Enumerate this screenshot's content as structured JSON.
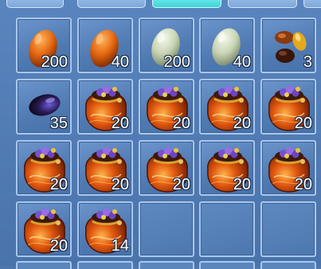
{
  "inventory": {
    "slots": [
      {
        "item": "orange-egg",
        "qty": "200"
      },
      {
        "item": "orange-egg",
        "qty": "40"
      },
      {
        "item": "pale-green-egg",
        "qty": "200"
      },
      {
        "item": "pale-green-egg",
        "qty": "40"
      },
      {
        "item": "gem-stones",
        "qty": "3"
      },
      {
        "item": "dark-purple-egg",
        "qty": "35"
      },
      {
        "item": "treasure-pouch",
        "qty": "20"
      },
      {
        "item": "treasure-pouch",
        "qty": "20"
      },
      {
        "item": "treasure-pouch",
        "qty": "20"
      },
      {
        "item": "treasure-pouch",
        "qty": "20"
      },
      {
        "item": "treasure-pouch",
        "qty": "20"
      },
      {
        "item": "treasure-pouch",
        "qty": "20"
      },
      {
        "item": "treasure-pouch",
        "qty": "20"
      },
      {
        "item": "treasure-pouch",
        "qty": "20"
      },
      {
        "item": "treasure-pouch",
        "qty": "20"
      },
      {
        "item": "treasure-pouch",
        "qty": "20"
      },
      {
        "item": "treasure-pouch",
        "qty": "14"
      },
      {
        "item": "",
        "qty": ""
      },
      {
        "item": "",
        "qty": ""
      },
      {
        "item": "",
        "qty": ""
      }
    ]
  },
  "colors": {
    "panel": "#4f77ac",
    "slot_border": "#a9c7ee",
    "active_tab": "#3fd3d8"
  }
}
